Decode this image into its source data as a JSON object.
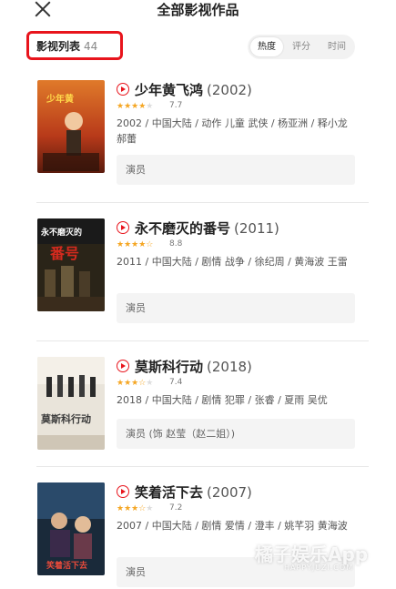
{
  "header": {
    "title": "全部影视作品"
  },
  "list": {
    "label": "影视列表",
    "count": "44"
  },
  "sort_tabs": [
    "热度",
    "评分",
    "时间"
  ],
  "movies": [
    {
      "title": "少年黄飞鸿",
      "year": "(2002)",
      "rating": "7.7",
      "stars": 4,
      "meta": "2002 / 中国大陆 / 动作 儿童 武侠 / 杨亚洲 / 释小龙 郝蕾",
      "role": "演员"
    },
    {
      "title": "永不磨灭的番号",
      "year": "(2011)",
      "rating": "8.8",
      "stars": 4.5,
      "meta": "2011 / 中国大陆 / 剧情 战争 / 徐纪周 / 黄海波 王雷",
      "role": "演员"
    },
    {
      "title": "莫斯科行动",
      "year": "(2018)",
      "rating": "7.4",
      "stars": 3.5,
      "meta": "2018 / 中国大陆 / 剧情 犯罪 / 张睿 / 夏雨 吴优",
      "role": "演员 (饰 赵莹（赵二姐）)"
    },
    {
      "title": "笑着活下去",
      "year": "(2007)",
      "rating": "7.2",
      "stars": 3.5,
      "meta": "2007 / 中国大陆 / 剧情 爱情 / 澄丰 / 姚芊羽 黄海波",
      "role": "演员"
    }
  ],
  "watermark": {
    "main": "橘子娱乐App",
    "sub": "HAPPYJUZI.COM"
  }
}
